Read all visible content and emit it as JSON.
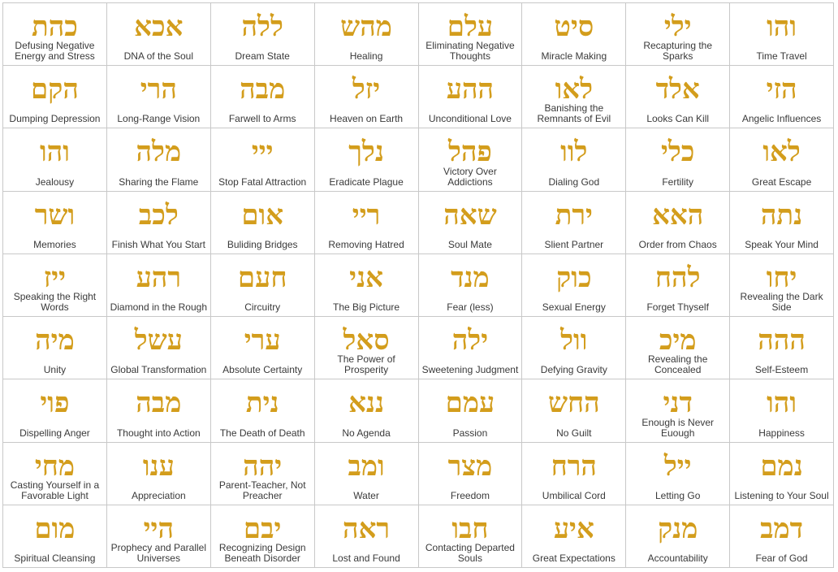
{
  "colors": {
    "hebrew": "#d39d1c",
    "label": "#3a3a3a",
    "grid": "#c8c8c8"
  },
  "cells": [
    {
      "hebrew": "כהת",
      "label": "Defusing Negative Energy and Stress"
    },
    {
      "hebrew": "אכא",
      "label": "DNA of the Soul"
    },
    {
      "hebrew": "ללה",
      "label": "Dream State"
    },
    {
      "hebrew": "מהש",
      "label": "Healing"
    },
    {
      "hebrew": "עלם",
      "label": "Eliminating Negative Thoughts"
    },
    {
      "hebrew": "סיט",
      "label": "Miracle Making"
    },
    {
      "hebrew": "ילי",
      "label": "Recapturing the Sparks"
    },
    {
      "hebrew": "והו",
      "label": "Time Travel"
    },
    {
      "hebrew": "הקם",
      "label": "Dumping Depression"
    },
    {
      "hebrew": "הרי",
      "label": "Long-Range Vision"
    },
    {
      "hebrew": "מבה",
      "label": "Farwell to Arms"
    },
    {
      "hebrew": "יזל",
      "label": "Heaven on Earth"
    },
    {
      "hebrew": "ההע",
      "label": "Unconditional Love"
    },
    {
      "hebrew": "לאו",
      "label": "Banishing the Remnants of Evil"
    },
    {
      "hebrew": "אלד",
      "label": "Looks Can Kill"
    },
    {
      "hebrew": "הזי",
      "label": "Angelic Influences"
    },
    {
      "hebrew": "והו",
      "label": "Jealousy"
    },
    {
      "hebrew": "מלה",
      "label": "Sharing the Flame"
    },
    {
      "hebrew": "ייי",
      "label": "Stop Fatal Attraction"
    },
    {
      "hebrew": "נלך",
      "label": "Eradicate Plague"
    },
    {
      "hebrew": "פהל",
      "label": "Victory Over Addictions"
    },
    {
      "hebrew": "לוו",
      "label": "Dialing God"
    },
    {
      "hebrew": "כלי",
      "label": "Fertility"
    },
    {
      "hebrew": "לאו",
      "label": "Great Escape"
    },
    {
      "hebrew": "ושר",
      "label": "Memories"
    },
    {
      "hebrew": "לכב",
      "label": "Finish What You Start"
    },
    {
      "hebrew": "אום",
      "label": "Buliding Bridges"
    },
    {
      "hebrew": "ריי",
      "label": "Removing Hatred"
    },
    {
      "hebrew": "שאה",
      "label": "Soul Mate"
    },
    {
      "hebrew": "ירת",
      "label": "Slient Partner"
    },
    {
      "hebrew": "האא",
      "label": "Order from Chaos"
    },
    {
      "hebrew": "נתה",
      "label": "Speak Your Mind"
    },
    {
      "hebrew": "ייז",
      "label": "Speaking the Right Words"
    },
    {
      "hebrew": "רהע",
      "label": "Diamond in the Rough"
    },
    {
      "hebrew": "חעם",
      "label": "Circuitry"
    },
    {
      "hebrew": "אני",
      "label": "The Big Picture"
    },
    {
      "hebrew": "מנד",
      "label": "Fear (less)"
    },
    {
      "hebrew": "כוק",
      "label": "Sexual Energy"
    },
    {
      "hebrew": "להח",
      "label": "Forget Thyself"
    },
    {
      "hebrew": "יחו",
      "label": "Revealing the Dark Side"
    },
    {
      "hebrew": "מיה",
      "label": "Unity"
    },
    {
      "hebrew": "עשל",
      "label": "Global Transformation"
    },
    {
      "hebrew": "ערי",
      "label": "Absolute Certainty"
    },
    {
      "hebrew": "סאל",
      "label": "The Power of Prosperity"
    },
    {
      "hebrew": "ילה",
      "label": "Sweetening Judgment"
    },
    {
      "hebrew": "וול",
      "label": "Defying Gravity"
    },
    {
      "hebrew": "מיכ",
      "label": "Revealing the Concealed"
    },
    {
      "hebrew": "ההה",
      "label": "Self-Esteem"
    },
    {
      "hebrew": "פוי",
      "label": "Dispelling Anger"
    },
    {
      "hebrew": "מבה",
      "label": "Thought into Action"
    },
    {
      "hebrew": "נית",
      "label": "The Death of Death"
    },
    {
      "hebrew": "ננא",
      "label": "No Agenda"
    },
    {
      "hebrew": "עמם",
      "label": "Passion"
    },
    {
      "hebrew": "החש",
      "label": "No Guilt"
    },
    {
      "hebrew": "דני",
      "label": "Enough is Never Euough"
    },
    {
      "hebrew": "והו",
      "label": "Happiness"
    },
    {
      "hebrew": "מחי",
      "label": "Casting Yourself in a Favorable Light"
    },
    {
      "hebrew": "ענו",
      "label": "Appreciation"
    },
    {
      "hebrew": "יהה",
      "label": "Parent-Teacher, Not Preacher"
    },
    {
      "hebrew": "ומב",
      "label": "Water"
    },
    {
      "hebrew": "מצר",
      "label": "Freedom"
    },
    {
      "hebrew": "הרח",
      "label": "Umbilical Cord"
    },
    {
      "hebrew": "ייל",
      "label": "Letting Go"
    },
    {
      "hebrew": "נמם",
      "label": "Listening to Your Soul"
    },
    {
      "hebrew": "מום",
      "label": "Spiritual Cleansing"
    },
    {
      "hebrew": "היי",
      "label": "Prophecy and Parallel Universes"
    },
    {
      "hebrew": "יבם",
      "label": "Recognizing Design Beneath Disorder"
    },
    {
      "hebrew": "ראה",
      "label": "Lost and Found"
    },
    {
      "hebrew": "חבו",
      "label": "Contacting Departed Souls"
    },
    {
      "hebrew": "איע",
      "label": "Great Expectations"
    },
    {
      "hebrew": "מנק",
      "label": "Accountability"
    },
    {
      "hebrew": "דמב",
      "label": "Fear of God"
    }
  ]
}
